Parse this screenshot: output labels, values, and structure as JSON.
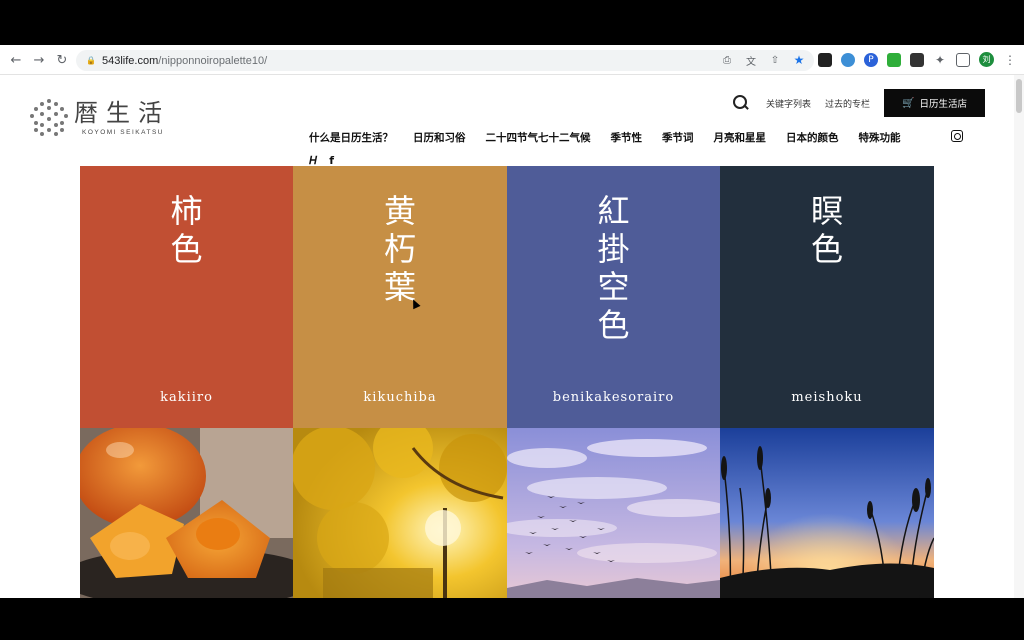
{
  "browser": {
    "url_host": "543life.com",
    "url_path": "/nipponnoiropalette10/",
    "profile_initial": "刘"
  },
  "header": {
    "logo_kanji": "暦生活",
    "logo_sub": "KOYOMI SEIKATSU",
    "link_keywords": "关键字列表",
    "link_past": "过去的专栏",
    "shop_label": "日历生活店"
  },
  "nav": {
    "items": [
      "什么是日历生活？",
      "日历和习俗",
      "二十四节气七十二气候",
      "季节性",
      "季节词",
      "月亮和星星",
      "日本的颜色",
      "特殊功能"
    ]
  },
  "colors": [
    {
      "kanji": [
        "柿",
        "色"
      ],
      "romaji": "kakiiro",
      "hex": "#c14f33",
      "photo": "persimmon"
    },
    {
      "kanji": [
        "黄",
        "朽",
        "葉"
      ],
      "romaji": "kikuchiba",
      "hex": "#c68f45",
      "photo": "ginkgo"
    },
    {
      "kanji": [
        "紅",
        "掛",
        "空",
        "色"
      ],
      "romaji": "benikakesorairo",
      "hex": "#4f5c98",
      "photo": "sky-birds"
    },
    {
      "kanji": [
        "瞑",
        "色"
      ],
      "romaji": "meishoku",
      "hex": "#222f3d",
      "photo": "dusk-grass"
    }
  ]
}
